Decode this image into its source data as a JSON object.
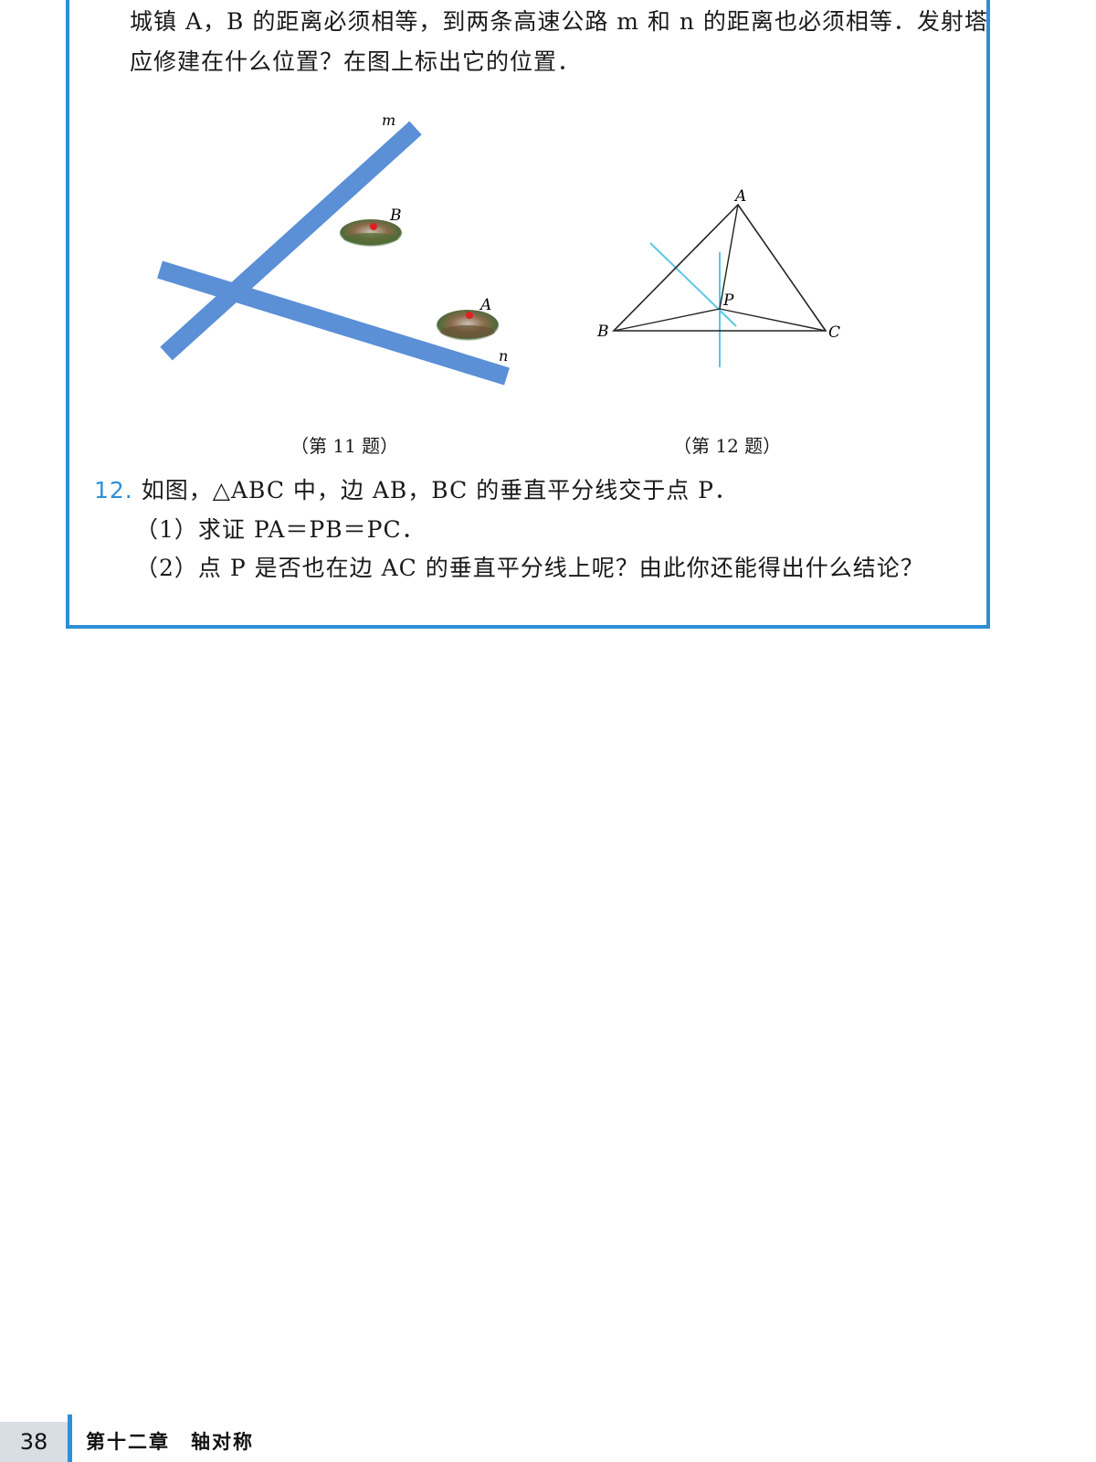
{
  "q11": {
    "line1": "城镇 A，B 的距离必须相等，到两条高速公路 m 和 n 的距离也必须相等．发射塔",
    "line2": "应修建在什么位置？在图上标出它的位置．",
    "figure": {
      "label_m": "m",
      "label_n": "n",
      "label_a": "A",
      "label_b": "B",
      "road_color": "#5b8fd6",
      "point_color": "#e02020"
    },
    "caption": "（第 11 题）"
  },
  "q12": {
    "number": "12.",
    "stem": "如图，△ABC 中，边 AB，BC 的垂直平分线交于点 P．",
    "part1": "（1）求证 PA＝PB＝PC．",
    "part2": "（2）点 P 是否也在边 AC 的垂直平分线上呢？由此你还能得出什么结论？",
    "figure": {
      "label_a": "A",
      "label_b": "B",
      "label_c": "C",
      "label_p": "P",
      "bisector_color": "#5cc6e6"
    },
    "caption": "（第 12 题）"
  },
  "footer": {
    "page_number": "38",
    "chapter": "第十二章　轴对称",
    "accent_color": "#2d8fd5"
  }
}
